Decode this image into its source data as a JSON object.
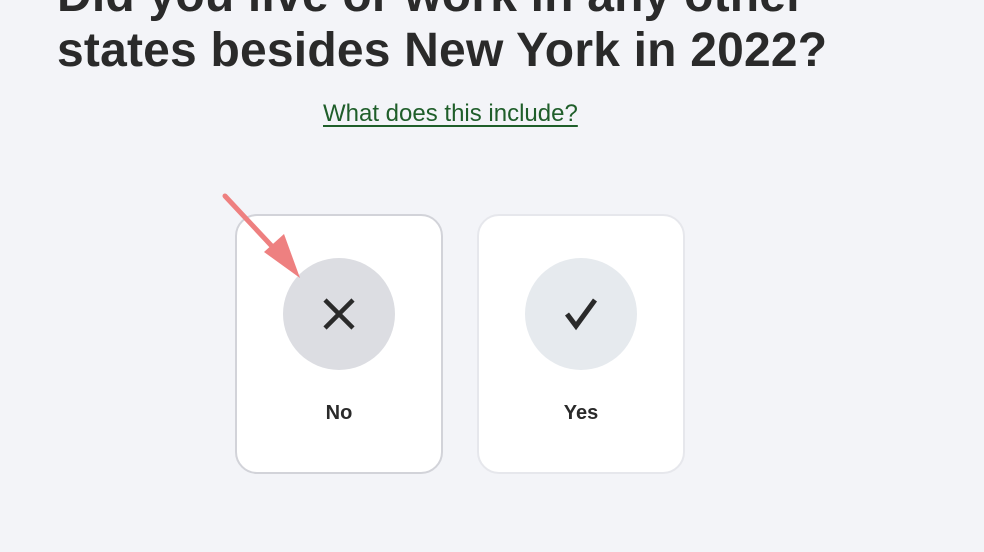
{
  "question": {
    "title_line_1": "Did you live or work in any other",
    "title_line_2": "states besides New York in 2022?"
  },
  "help_link": {
    "label": "What does this include?"
  },
  "options": [
    {
      "label": "No",
      "icon": "x-icon"
    },
    {
      "label": "Yes",
      "icon": "check-icon"
    }
  ],
  "annotation": {
    "arrow_color": "#ee8080",
    "target": "No"
  }
}
